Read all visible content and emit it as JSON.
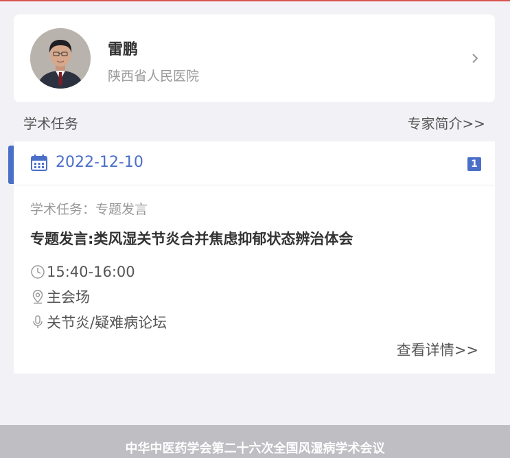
{
  "colors": {
    "accent": "#4a6fc9",
    "page_background": "#f2f2f6",
    "footer_background": "#bebec3",
    "top_line": "#d9534f"
  },
  "profile": {
    "name": "雷鹏",
    "hospital": "陕西省人民医院",
    "avatar_icon": "doctor-portrait",
    "chevron_icon": "chevron-right-icon"
  },
  "section": {
    "title": "学术任务",
    "link": "专家简介>>"
  },
  "task": {
    "date": "2022-12-10",
    "count": "1",
    "type": "学术任务：专题发言",
    "title": "专题发言:类风湿关节炎合并焦虑抑郁状态辨治体会",
    "time": "15:40-16:00",
    "venue": "主会场",
    "forum": "关节炎/疑难病论坛",
    "detail_link": "查看详情>>",
    "icons": [
      "calendar-icon",
      "clock-icon",
      "location-pin-icon",
      "microphone-icon"
    ]
  },
  "footer": {
    "text": "中华中医药学会第二十六次全国风湿病学术会议"
  }
}
